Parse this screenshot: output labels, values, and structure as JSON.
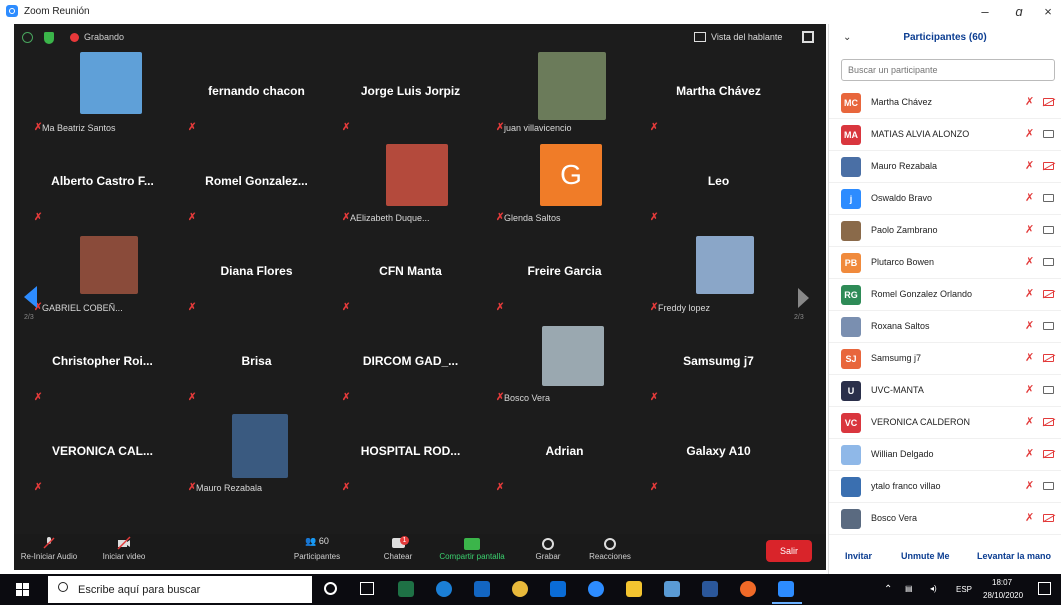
{
  "window": {
    "title": "Zoom Reunión",
    "minimize": "–",
    "restore": "ɑ",
    "close": "×"
  },
  "meeting": {
    "recording_label": "Grabando",
    "view_label": "Vista del hablante",
    "page_left": "2/3",
    "page_right": "2/3",
    "tiles": [
      {
        "name": "",
        "label": "Ma Beatriz Santos",
        "photo": true
      },
      {
        "name": "fernando chacon",
        "label": ""
      },
      {
        "name": "Jorge Luis Jorpiz",
        "label": ""
      },
      {
        "name": "",
        "label": "juan villavicencio",
        "photo": true
      },
      {
        "name": "Martha Chávez",
        "label": ""
      },
      {
        "name": "Alberto Castro F...",
        "label": ""
      },
      {
        "name": "Romel Gonzalez...",
        "label": ""
      },
      {
        "name": "",
        "label": "AElizabeth Duque...",
        "photo": true
      },
      {
        "name": "",
        "label": "Glenda Saltos",
        "photo": true,
        "initial": "G"
      },
      {
        "name": "Leo",
        "label": ""
      },
      {
        "name": "",
        "label": "GABRIEL COBEÑ...",
        "photo": true
      },
      {
        "name": "Diana Flores",
        "label": ""
      },
      {
        "name": "CFN Manta",
        "label": ""
      },
      {
        "name": "Freire Garcia",
        "label": ""
      },
      {
        "name": "",
        "label": "Freddy lopez",
        "photo": true
      },
      {
        "name": "Christopher Roi...",
        "label": ""
      },
      {
        "name": "Brisa",
        "label": ""
      },
      {
        "name": "DIRCOM GAD_...",
        "label": ""
      },
      {
        "name": "",
        "label": "Bosco Vera",
        "photo": true
      },
      {
        "name": "Samsumg j7",
        "label": ""
      },
      {
        "name": "VERONICA CAL...",
        "label": ""
      },
      {
        "name": "",
        "label": "Mauro Rezabala",
        "photo": true
      },
      {
        "name": "HOSPITAL ROD...",
        "label": ""
      },
      {
        "name": "Adrian",
        "label": ""
      },
      {
        "name": "Galaxy A10",
        "label": ""
      }
    ],
    "toolbar": {
      "audio": "Re-Iniciar Audio",
      "video": "Iniciar video",
      "participants": "Participantes",
      "participants_count": "60",
      "chat": "Chatear",
      "chat_badge": "1",
      "share": "Compartir pantalla",
      "record": "Grabar",
      "reactions": "Reacciones",
      "leave": "Salir"
    }
  },
  "panel": {
    "title": "Participantes (60)",
    "search_placeholder": "Buscar un participante",
    "participants": [
      {
        "initials": "MC",
        "name": "Martha Chávez",
        "color": "#e8663c",
        "video_off": true
      },
      {
        "initials": "MA",
        "name": "MATIAS ALVIA ALONZO",
        "color": "#d9363e",
        "video_off": false
      },
      {
        "initials": "",
        "name": "Mauro Rezabala",
        "color": "#4a6fa5",
        "video_off": true
      },
      {
        "initials": "j",
        "name": "Oswaldo Bravo",
        "color": "#2d8cff",
        "video_off": false
      },
      {
        "initials": "",
        "name": "Paolo Zambrano",
        "color": "#8a6a4a",
        "video_off": false
      },
      {
        "initials": "PB",
        "name": "Plutarco Bowen",
        "color": "#f08a3c",
        "video_off": false
      },
      {
        "initials": "RG",
        "name": "Romel Gonzalez Orlando",
        "color": "#2e8b57",
        "video_off": true
      },
      {
        "initials": "",
        "name": "Roxana Saltos",
        "color": "#7a8fb0",
        "video_off": false
      },
      {
        "initials": "SJ",
        "name": "Samsumg j7",
        "color": "#e8663c",
        "video_off": true
      },
      {
        "initials": "U",
        "name": "UVC-MANTA",
        "color": "#2a2f4a",
        "video_off": false
      },
      {
        "initials": "VC",
        "name": "VERONICA CALDERON",
        "color": "#d9363e",
        "video_off": true
      },
      {
        "initials": "",
        "name": "Willian Delgado",
        "color": "#8fb8e8",
        "video_off": true
      },
      {
        "initials": "",
        "name": "ytalo franco villao",
        "color": "#3a6fb0",
        "video_off": false
      },
      {
        "initials": "",
        "name": "Bosco Vera",
        "color": "#5a6a80",
        "video_off": true
      }
    ],
    "footer": {
      "invite": "Invitar",
      "unmute": "Unmute Me",
      "raise": "Levantar la mano"
    }
  },
  "taskbar": {
    "search_text": "Escribe aquí para buscar",
    "lang": "ESP",
    "time": "18:07",
    "date": "28/10/2020"
  }
}
